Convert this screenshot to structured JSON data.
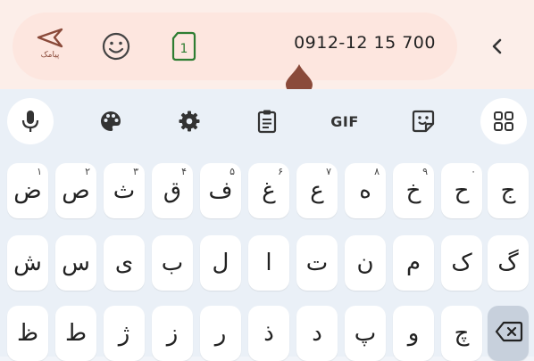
{
  "header": {
    "send_label": "پیامک",
    "sim_number": "1",
    "phone_number": "0912-12 15 700",
    "send_icon": "send-icon",
    "emoji_icon": "smiley-icon",
    "back_icon": "chevron-left-icon",
    "accent": "#8a4a3a"
  },
  "toolbar": {
    "items": [
      "mic-icon",
      "palette-icon",
      "gear-icon",
      "clipboard-icon",
      "gif-button",
      "sticker-icon",
      "grid-icon"
    ],
    "gif_label": "GIF"
  },
  "rows": [
    [
      {
        "ch": "ض",
        "hint": "۱"
      },
      {
        "ch": "ص",
        "hint": "۲"
      },
      {
        "ch": "ث",
        "hint": "۳"
      },
      {
        "ch": "ق",
        "hint": "۴"
      },
      {
        "ch": "ف",
        "hint": "۵"
      },
      {
        "ch": "غ",
        "hint": "۶"
      },
      {
        "ch": "ع",
        "hint": "۷"
      },
      {
        "ch": "ه",
        "hint": "۸"
      },
      {
        "ch": "خ",
        "hint": "۹"
      },
      {
        "ch": "ح",
        "hint": "۰"
      },
      {
        "ch": "ج",
        "hint": ""
      }
    ],
    [
      {
        "ch": "ش"
      },
      {
        "ch": "س"
      },
      {
        "ch": "ی"
      },
      {
        "ch": "ب"
      },
      {
        "ch": "ل"
      },
      {
        "ch": "ا"
      },
      {
        "ch": "ت"
      },
      {
        "ch": "ن"
      },
      {
        "ch": "م"
      },
      {
        "ch": "ک"
      },
      {
        "ch": "گ"
      }
    ],
    [
      {
        "ch": "ظ"
      },
      {
        "ch": "ط"
      },
      {
        "ch": "ژ"
      },
      {
        "ch": "ز"
      },
      {
        "ch": "ر"
      },
      {
        "ch": "ذ"
      },
      {
        "ch": "د"
      },
      {
        "ch": "پ"
      },
      {
        "ch": "و"
      },
      {
        "ch": "چ"
      }
    ]
  ]
}
